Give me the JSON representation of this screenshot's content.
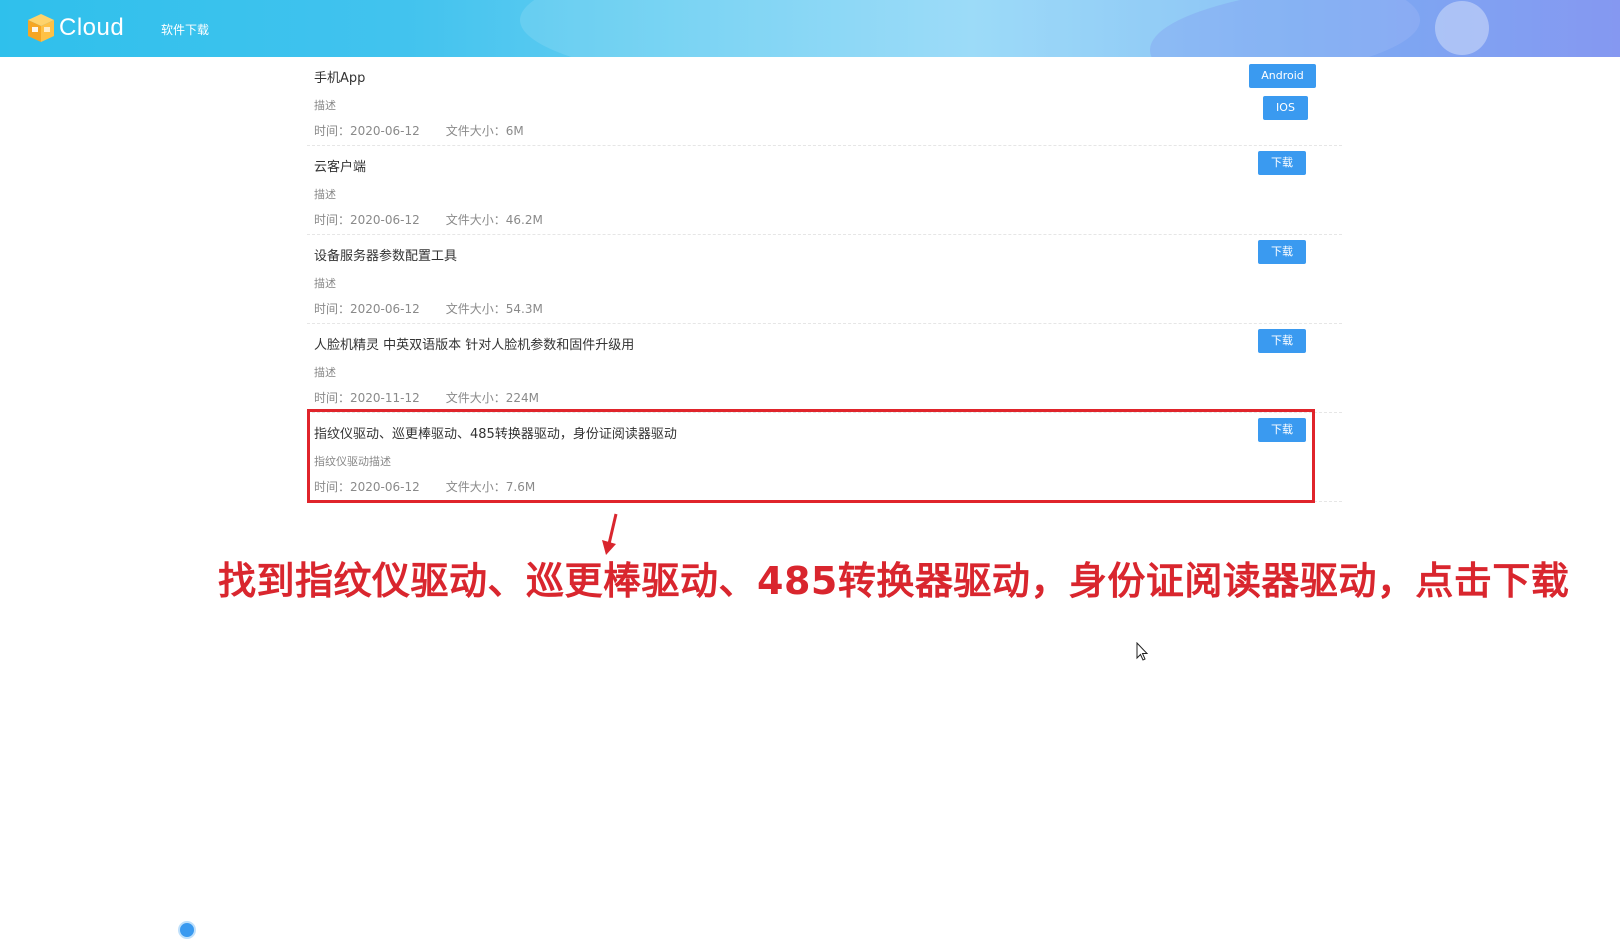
{
  "header": {
    "logo_text": "Cloud",
    "nav": [
      "软件下载"
    ],
    "gradient_start": "#2fc0ec",
    "gradient_end": "#8a9ff2"
  },
  "items": [
    {
      "name": "手机App",
      "desc": "描述",
      "time": "时间：2020-06-12",
      "size": "文件大小：6M",
      "buttons": [
        "Android",
        "IOS"
      ]
    },
    {
      "name": "云客户端",
      "desc": "描述",
      "time": "时间：2020-06-12",
      "size": "文件大小：46.2M",
      "buttons": [
        "下载"
      ]
    },
    {
      "name": "设备服务器参数配置工具",
      "desc": "描述",
      "time": "时间：2020-06-12",
      "size": "文件大小：54.3M",
      "buttons": [
        "下载"
      ]
    },
    {
      "name": "人脸机精灵 中英双语版本 针对人脸机参数和固件升级用",
      "desc": "描述",
      "time": "时间：2020-11-12",
      "size": "文件大小：224M",
      "buttons": [
        "下载"
      ]
    },
    {
      "name": "指纹仪驱动、巡更棒驱动、485转换器驱动，身份证阅读器驱动",
      "desc": "指纹仪驱动描述",
      "time": "时间：2020-06-12",
      "size": "文件大小：7.6M",
      "buttons": [
        "下载"
      ]
    }
  ],
  "annotation": {
    "text": "找到指纹仪驱动、巡更棒驱动、485转换器驱动，身份证阅读器驱动，点击下载",
    "color": "#d9262e"
  },
  "colors": {
    "button": "#3a9af0",
    "highlight_border": "#e0242b"
  },
  "icons": [
    "cloud-box-logo-icon",
    "arrow-down-icon",
    "mouse-cursor-icon"
  ]
}
